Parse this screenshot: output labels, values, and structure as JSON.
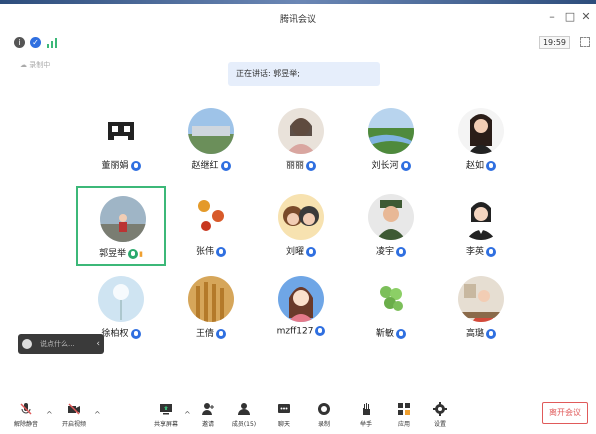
{
  "window": {
    "title": "腾讯会议",
    "minimize": "–",
    "maximize": "□",
    "close": "✕"
  },
  "status": {
    "time": "19:59"
  },
  "recording_label": "录制中",
  "speaking": {
    "label": "正在讲话: 郭昱举;"
  },
  "participants": [
    {
      "name": "董丽娟",
      "icon": "pixel-character"
    },
    {
      "name": "赵继红",
      "icon": "landscape"
    },
    {
      "name": "丽丽",
      "icon": "portrait-woman"
    },
    {
      "name": "刘长河",
      "icon": "river-landscape"
    },
    {
      "name": "赵如",
      "icon": "portrait-woman-dark"
    },
    {
      "name": "郭昱举",
      "icon": "portrait-outdoor",
      "active": true
    },
    {
      "name": "张伟",
      "icon": "flowers"
    },
    {
      "name": "刘曜",
      "icon": "cartoon-couple"
    },
    {
      "name": "凌宇",
      "icon": "portrait-uniform"
    },
    {
      "name": "李英",
      "icon": "portrait-woman-formal"
    },
    {
      "name": "徐柏权",
      "icon": "dandelion"
    },
    {
      "name": "王倩",
      "icon": "wheat"
    },
    {
      "name": "mzff127",
      "icon": "cartoon-girl"
    },
    {
      "name": "靳敏",
      "icon": "grapes"
    },
    {
      "name": "高璐",
      "icon": "portrait-desk"
    }
  ],
  "chat": {
    "placeholder": "说点什么..."
  },
  "toolbar": {
    "unmute": "解除静音",
    "start_video": "开启视频",
    "share_screen": "共享屏幕",
    "invite": "邀请",
    "members": "成员(15)",
    "chat": "聊天",
    "record": "录制",
    "raise_hand": "举手",
    "apps": "应用",
    "settings": "设置",
    "leave": "离开会议"
  },
  "colors": {
    "active_border": "#3cb878",
    "mic_blue": "#2f6fe0",
    "leave_red": "#e05a5a"
  }
}
